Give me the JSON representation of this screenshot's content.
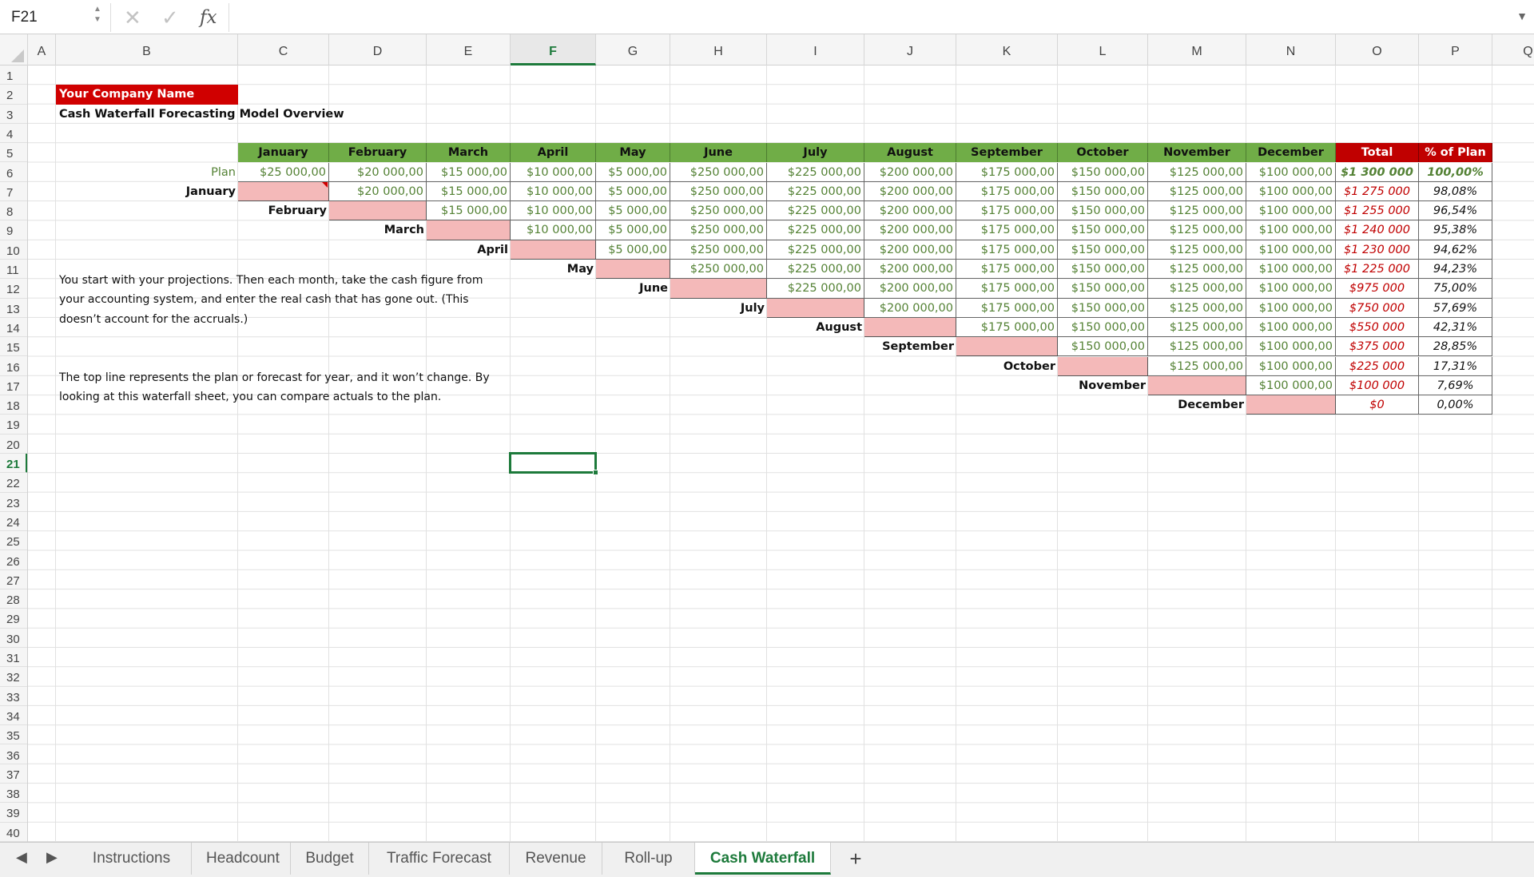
{
  "formula_bar": {
    "name_box": "F21",
    "cancel_glyph": "✕",
    "confirm_glyph": "✓",
    "fx_label": "fx",
    "formula_value": ""
  },
  "columns": [
    "A",
    "B",
    "C",
    "D",
    "E",
    "F",
    "G",
    "H",
    "I",
    "J",
    "K",
    "L",
    "M",
    "N",
    "O",
    "P",
    "Q"
  ],
  "selected_column": "F",
  "selected_row": 21,
  "row_count": 40,
  "sheet": {
    "company_name": "Your Company Name",
    "subtitle": "Cash Waterfall Forecasting Model Overview",
    "month_headers": [
      "January",
      "February",
      "March",
      "April",
      "May",
      "June",
      "July",
      "August",
      "September",
      "October",
      "November",
      "December"
    ],
    "total_header": "Total",
    "pct_header": "% of Plan",
    "plan_label": "Plan",
    "plan_values": [
      "$25 000,00",
      "$20 000,00",
      "$15 000,00",
      "$10 000,00",
      "$5 000,00",
      "$250 000,00",
      "$225 000,00",
      "$200 000,00",
      "$175 000,00",
      "$150 000,00",
      "$125 000,00",
      "$100 000,00"
    ],
    "row_labels": [
      "January",
      "February",
      "March",
      "April",
      "May",
      "June",
      "July",
      "August",
      "September",
      "October",
      "November",
      "December"
    ],
    "totals": [
      "$1 300 000",
      "$1 275 000",
      "$1 255 000",
      "$1 240 000",
      "$1 230 000",
      "$1 225 000",
      "$975 000",
      "$750 000",
      "$550 000",
      "$375 000",
      "$225 000",
      "$100 000",
      "$0"
    ],
    "pcts": [
      "100,00%",
      "98,08%",
      "96,54%",
      "95,38%",
      "94,62%",
      "94,23%",
      "75,00%",
      "57,69%",
      "42,31%",
      "28,85%",
      "17,31%",
      "7,69%",
      "0,00%"
    ],
    "paragraph1": "You start with your projections. Then each month, take the cash figure from your accounting system, and enter the real cash that has gone out. (This doesn’t account for the accruals.)",
    "paragraph2": "The top line represents the plan or forecast for year, and it won’t change. By looking at this waterfall sheet, you can compare actuals to the plan."
  },
  "tabs": {
    "items": [
      "Instructions",
      "Headcount",
      "Budget",
      "Traffic Forecast",
      "Revenue",
      "Roll-up",
      "Cash Waterfall"
    ],
    "active": "Cash Waterfall",
    "add_glyph": "+"
  },
  "colors": {
    "accent": "#1d7a3b",
    "header_green": "#70ad47",
    "value_green": "#548235",
    "header_red": "#c00000",
    "company_red": "#d00000",
    "pending_pink": "#f4b9b9"
  }
}
